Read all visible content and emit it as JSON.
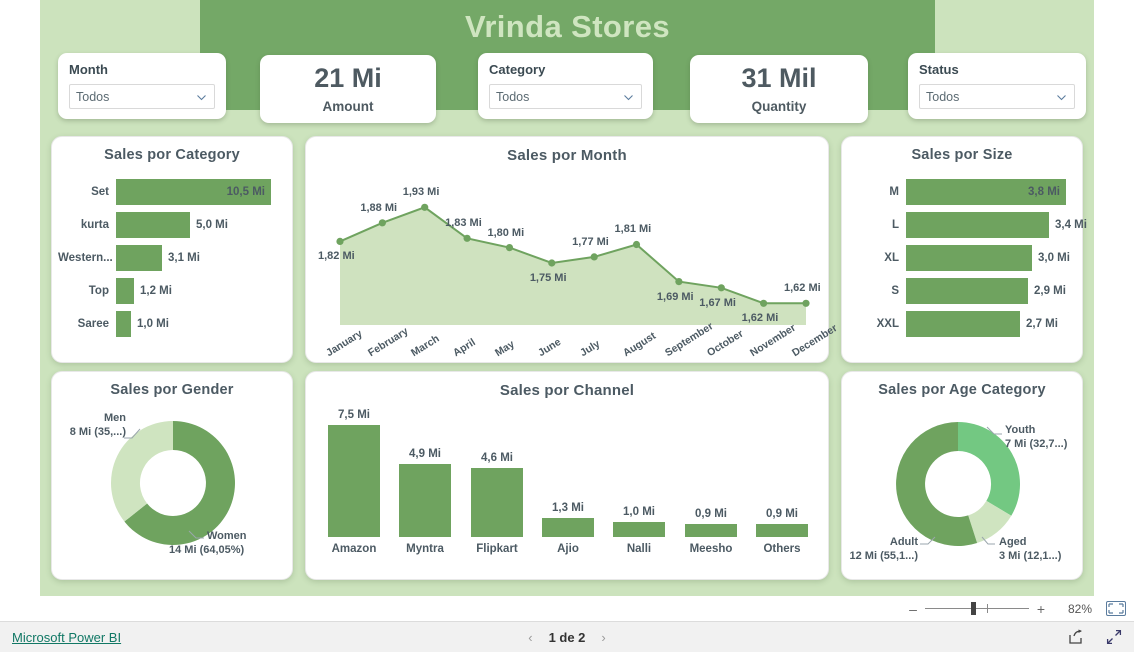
{
  "header": {
    "title": "Vrinda Stores"
  },
  "slicers": [
    {
      "name": "month",
      "label": "Month",
      "value": "Todos",
      "icon": "chevron-down-icon"
    },
    {
      "name": "category",
      "label": "Category",
      "value": "Todos",
      "icon": "chevron-down-icon"
    },
    {
      "name": "status",
      "label": "Status",
      "value": "Todos",
      "icon": "chevron-down-icon"
    }
  ],
  "kpis": [
    {
      "name": "amount",
      "value": "21 Mi",
      "label": "Amount"
    },
    {
      "name": "quantity",
      "value": "31 Mil",
      "label": "Quantity"
    }
  ],
  "panels": {
    "category": {
      "title": "Sales por Category"
    },
    "month": {
      "title": "Sales por Month"
    },
    "size": {
      "title": "Sales por Size"
    },
    "gender": {
      "title": "Sales por Gender"
    },
    "channel": {
      "title": "Sales por Channel"
    },
    "age": {
      "title": "Sales por Age Category"
    }
  },
  "colors": {
    "canvas_bg": "#cce3bd",
    "header_band": "#74a867",
    "title_text": "#cfe5c0",
    "bar_green": "#6fa35f",
    "area_fill": "#cfe2bf",
    "line_green": "#6fa35f",
    "donut_dark": "#6fa35f",
    "donut_light": "#cfe4c0",
    "donut_bright": "#73c882",
    "donut_mid": "#6fa35f",
    "link_teal": "#117865",
    "label_text": "#4c5a63"
  },
  "chart_data": [
    {
      "name": "sales-por-category",
      "type": "bar",
      "orientation": "horizontal",
      "title": "Sales por Category",
      "categories": [
        "Set",
        "kurta",
        "Western...",
        "Top",
        "Saree"
      ],
      "values": [
        10.5,
        5.0,
        3.1,
        1.2,
        1.0
      ],
      "labels": [
        "10,5 Mi",
        "5,0 Mi",
        "3,1 Mi",
        "1,2 Mi",
        "1,0 Mi"
      ],
      "label_inside": [
        true,
        false,
        false,
        false,
        false
      ],
      "unit": "Mi",
      "xlabel": "",
      "ylabel": "",
      "grid": false,
      "legend": "none"
    },
    {
      "name": "sales-por-month",
      "type": "area",
      "title": "Sales por Month",
      "categories": [
        "January",
        "February",
        "March",
        "April",
        "May",
        "June",
        "July",
        "August",
        "September",
        "October",
        "November",
        "December"
      ],
      "values": [
        1.82,
        1.88,
        1.93,
        1.83,
        1.8,
        1.75,
        1.77,
        1.81,
        1.69,
        1.67,
        1.62,
        1.62
      ],
      "labels": [
        "1,82 Mi",
        "1,88 Mi",
        "1,93 Mi",
        "1,83 Mi",
        "1,80 Mi",
        "1,75 Mi",
        "1,77 Mi",
        "1,81 Mi",
        "1,69 Mi",
        "1,67 Mi",
        "1,62 Mi",
        "1,62 Mi"
      ],
      "label_below": [
        true,
        false,
        false,
        false,
        false,
        true,
        false,
        false,
        true,
        true,
        true,
        false
      ],
      "ylim": [
        1.55,
        1.96
      ],
      "unit": "Mi",
      "xlabel": "",
      "ylabel": "",
      "grid": false,
      "legend": "none"
    },
    {
      "name": "sales-por-size",
      "type": "bar",
      "orientation": "horizontal",
      "title": "Sales por Size",
      "categories": [
        "M",
        "L",
        "XL",
        "S",
        "XXL"
      ],
      "values": [
        3.8,
        3.4,
        3.0,
        2.9,
        2.7
      ],
      "labels": [
        "3,8 Mi",
        "3,4 Mi",
        "3,0 Mi",
        "2,9 Mi",
        "2,7 Mi"
      ],
      "label_inside": [
        true,
        false,
        false,
        false,
        false
      ],
      "unit": "Mi",
      "xlabel": "",
      "ylabel": "",
      "grid": false,
      "legend": "none"
    },
    {
      "name": "sales-por-gender",
      "type": "pie",
      "subtype": "donut",
      "title": "Sales por Gender",
      "categories": [
        "Women",
        "Men"
      ],
      "values": [
        14,
        8
      ],
      "percents": [
        64.05,
        35.95
      ],
      "labels": [
        "Women\n14 Mi (64,05%)",
        "Men\n8 Mi (35,...)"
      ],
      "slice_colors": [
        "#6fa35f",
        "#cfe4c0"
      ],
      "legend": "callout-labels"
    },
    {
      "name": "sales-por-channel",
      "type": "bar",
      "orientation": "vertical",
      "title": "Sales por Channel",
      "categories": [
        "Amazon",
        "Myntra",
        "Flipkart",
        "Ajio",
        "Nalli",
        "Meesho",
        "Others"
      ],
      "values": [
        7.5,
        4.9,
        4.6,
        1.3,
        1.0,
        0.9,
        0.9
      ],
      "labels": [
        "7,5 Mi",
        "4,9 Mi",
        "4,6 Mi",
        "1,3 Mi",
        "1,0 Mi",
        "0,9 Mi",
        "0,9 Mi"
      ],
      "ylim": [
        0,
        7.5
      ],
      "unit": "Mi",
      "xlabel": "",
      "ylabel": "",
      "grid": false,
      "legend": "none"
    },
    {
      "name": "sales-por-age-category",
      "type": "pie",
      "subtype": "donut",
      "title": "Sales por Age Category",
      "categories": [
        "Youth",
        "Aged",
        "Adult"
      ],
      "values": [
        7,
        3,
        12
      ],
      "percents": [
        32.7,
        12.1,
        55.1
      ],
      "labels": [
        "Youth\n7 Mi (32,7...)",
        "Aged\n3 Mi (12,1...)",
        "Adult\n12 Mi (55,1...)"
      ],
      "slice_colors": [
        "#73c882",
        "#cfe4c0",
        "#6fa35f"
      ],
      "legend": "callout-labels"
    }
  ],
  "donut_gender": {
    "women_name": "Women",
    "women_value": "14 Mi (64,05%)",
    "men_name": "Men",
    "men_value": "8 Mi (35,...)"
  },
  "donut_age": {
    "youth_name": "Youth",
    "youth_value": "7 Mi (32,7...)",
    "aged_name": "Aged",
    "aged_value": "3 Mi (12,1...)",
    "adult_name": "Adult",
    "adult_value": "12 Mi (55,1...)"
  },
  "zoombar": {
    "minus": "–",
    "plus": "+",
    "percent": "82%",
    "fit_icon": "fit-to-page-icon"
  },
  "footer": {
    "link": "Microsoft Power BI",
    "prev_icon": "chevron-left-icon",
    "page_text": "1 de 2",
    "next_icon": "chevron-right-icon",
    "share_icon": "share-icon",
    "fullscreen_icon": "fullscreen-icon"
  }
}
